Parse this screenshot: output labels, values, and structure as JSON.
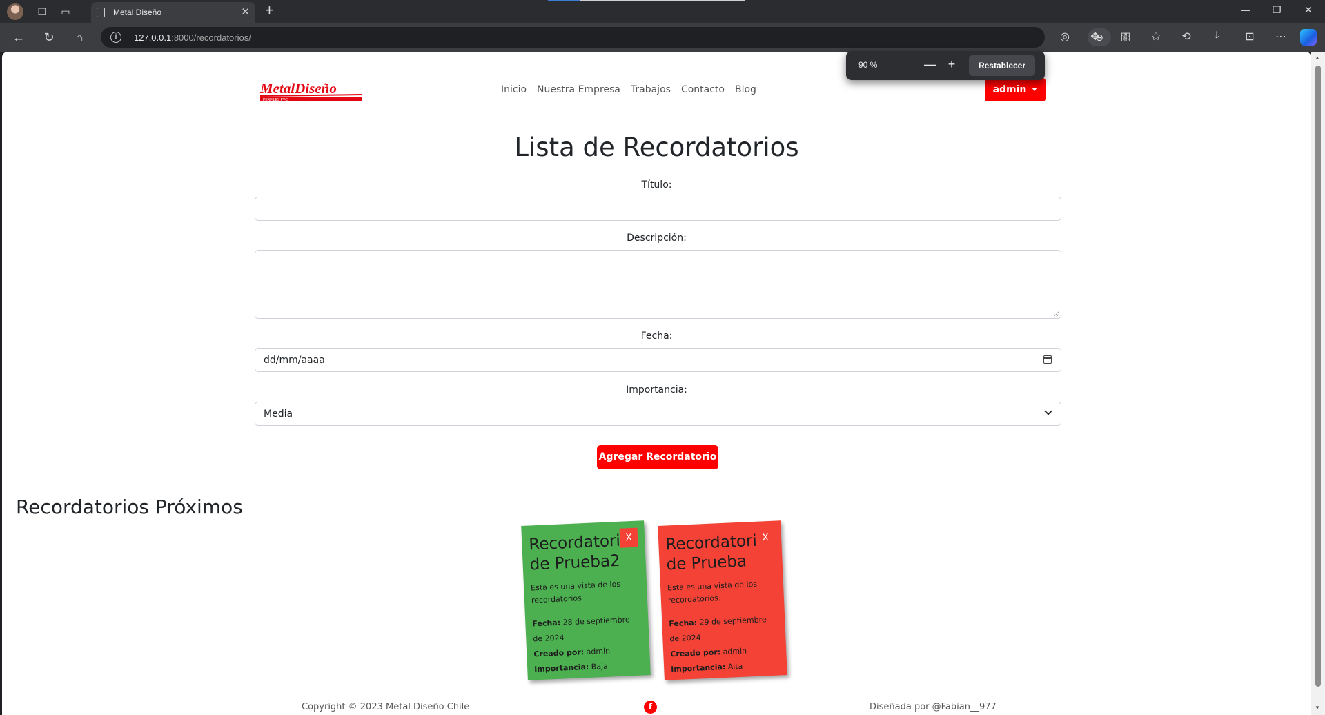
{
  "browser": {
    "tab_title": "Metal Diseño",
    "url_host": "127.0.0.1",
    "url_path": ":8000/recordatorios/",
    "zoom_popup": {
      "percent": "90 %",
      "reset_label": "Restablecer"
    }
  },
  "header": {
    "logo_text": "MetalDiseño",
    "logo_tagline": "PERFILES PVC",
    "nav_items": [
      "Inicio",
      "Nuestra Empresa",
      "Trabajos",
      "Contacto",
      "Blog"
    ],
    "user_button": "admin"
  },
  "form": {
    "heading": "Lista de Recordatorios",
    "title_label": "Título:",
    "title_value": "",
    "description_label": "Descripción:",
    "description_value": "",
    "date_label": "Fecha:",
    "date_value": "dd/mm/aaaa",
    "importance_label": "Importancia:",
    "importance_value": "Media",
    "submit_label": "Agregar Recordatorio"
  },
  "upcoming": {
    "heading": "Recordatorios Próximos",
    "cards": [
      {
        "title": "Recordatorio de Prueba2",
        "description": "Esta es una vista de los recordatorios",
        "date_label": "Fecha:",
        "date": "28 de septiembre de 2024",
        "creator_label": "Creado por:",
        "creator": "admin",
        "importance_label": "Importancia:",
        "importance": "Baja",
        "color": "#4caf50",
        "close_label": "X"
      },
      {
        "title": "Recordatorio de Prueba",
        "description": "Esta es una vista de los recordatorios.",
        "date_label": "Fecha:",
        "date": "29 de septiembre de 2024",
        "creator_label": "Creado por:",
        "creator": "admin",
        "importance_label": "Importancia:",
        "importance": "Alta",
        "color": "#f44336",
        "close_label": "X"
      }
    ]
  },
  "footer": {
    "copyright": "Copyright © 2023 Metal Diseño Chile",
    "credit": "Diseñada por @Fabian__977",
    "social_icon": "facebook-icon"
  },
  "colors": {
    "brand_red": "#ff0000",
    "card_green": "#4caf50",
    "card_red": "#f44336"
  }
}
